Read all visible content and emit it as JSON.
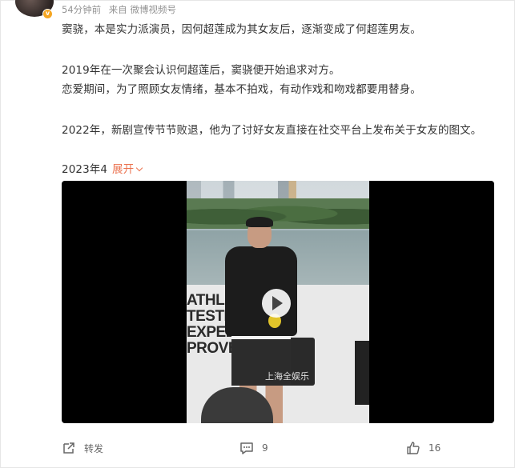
{
  "meta": {
    "time": "54分钟前",
    "source": "来自 微博视频号"
  },
  "post": {
    "line1": "窦骁，本是实力派演员，因何超莲成为其女友后，逐渐变成了何超莲男友。",
    "line2": "2019年在一次聚会认识何超莲后，窦骁便开始追求对方。",
    "line3": "恋爱期间，为了照顾女友情绪，基本不拍戏，有动作戏和吻戏都要用替身。",
    "line4": "2022年，新剧宣传节节败退，他为了讨好女友直接在社交平台上发布关于女友的图文。",
    "line5": "2023年4",
    "expand_label": "展开"
  },
  "video": {
    "banner_lines": [
      "ATHLE",
      "TESTE",
      "EXPED",
      "PROVE"
    ],
    "watermark": "上海全娱乐"
  },
  "actions": {
    "repost_label": "转发",
    "comment_count": "9",
    "like_count": "16"
  },
  "icons": {
    "avatar_badge": "verified-badge-icon",
    "repost": "share-icon",
    "comment": "comment-icon",
    "like": "thumbs-up-icon",
    "play": "play-icon"
  },
  "colors": {
    "accent": "#eb7350",
    "meta": "#939393",
    "badge": "#f5a623"
  }
}
